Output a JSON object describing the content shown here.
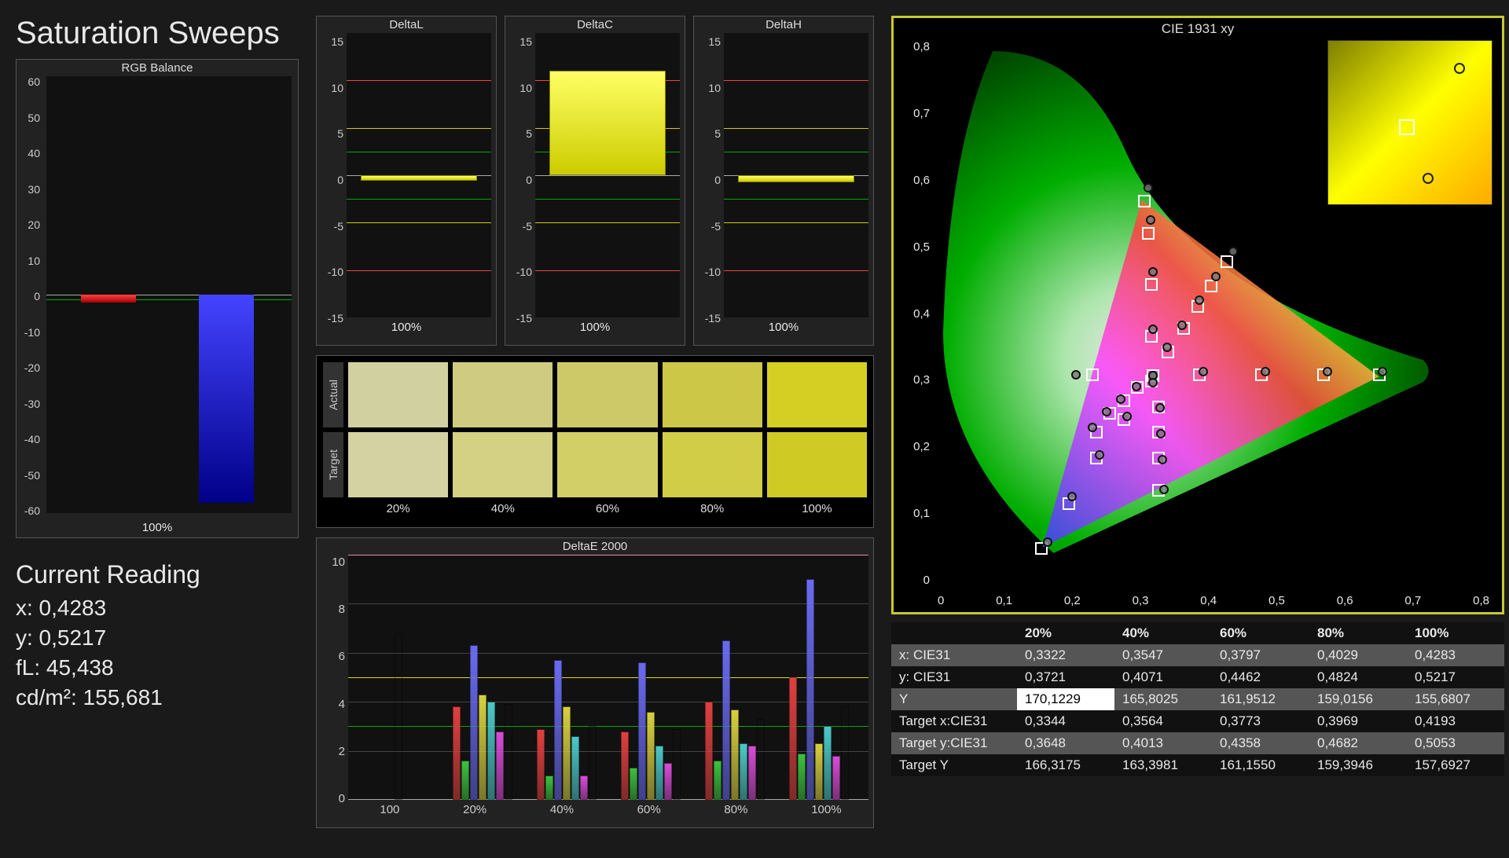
{
  "page": {
    "title": "Saturation Sweeps"
  },
  "current_reading": {
    "title": "Current Reading",
    "x": "x: 0,4283",
    "y": "y: 0,5217",
    "fL": "fL: 45,438",
    "cdm2": "cd/m²: 155,681"
  },
  "rgb_balance": {
    "title": "RGB Balance",
    "xlabel": "100%"
  },
  "delta_panels": {
    "L": {
      "title": "DeltaL",
      "xlabel": "100%"
    },
    "C": {
      "title": "DeltaC",
      "xlabel": "100%"
    },
    "H": {
      "title": "DeltaH",
      "xlabel": "100%"
    }
  },
  "swatches": {
    "row1": "Actual",
    "row2": "Target",
    "labels": [
      "20%",
      "40%",
      "60%",
      "80%",
      "100%"
    ],
    "actual": [
      "#d1d0a0",
      "#cfcc82",
      "#cdc968",
      "#cdc748",
      "#d4cf22"
    ],
    "target": [
      "#d4d2a2",
      "#d4d084",
      "#d3cf67",
      "#d1cd46",
      "#d0cb24"
    ]
  },
  "deltaE2000": {
    "title": "DeltaE 2000"
  },
  "cie": {
    "title": "CIE 1931 xy",
    "xticks": [
      "0",
      "0,1",
      "0,2",
      "0,3",
      "0,4",
      "0,5",
      "0,6",
      "0,7",
      "0,8"
    ],
    "yticks": [
      "0",
      "0,1",
      "0,2",
      "0,3",
      "0,4",
      "0,5",
      "0,6",
      "0,7",
      "0,8"
    ]
  },
  "table": {
    "columns": [
      "",
      "20%",
      "40%",
      "60%",
      "80%",
      "100%"
    ],
    "rows": [
      {
        "h": "x: CIE31",
        "v": [
          "0,3322",
          "0,3547",
          "0,3797",
          "0,4029",
          "0,4283"
        ]
      },
      {
        "h": "y: CIE31",
        "v": [
          "0,3721",
          "0,4071",
          "0,4462",
          "0,4824",
          "0,5217"
        ]
      },
      {
        "h": "Y",
        "v": [
          "170,1229",
          "165,8025",
          "161,9512",
          "159,0156",
          "155,6807"
        ],
        "hl": 0
      },
      {
        "h": "Target x:CIE31",
        "v": [
          "0,3344",
          "0,3564",
          "0,3773",
          "0,3969",
          "0,4193"
        ]
      },
      {
        "h": "Target y:CIE31",
        "v": [
          "0,3648",
          "0,4013",
          "0,4358",
          "0,4682",
          "0,5053"
        ]
      },
      {
        "h": "Target Y",
        "v": [
          "166,3175",
          "163,3981",
          "161,1550",
          "159,3946",
          "157,6927"
        ]
      }
    ]
  },
  "chart_data": [
    {
      "id": "rgb_balance",
      "type": "bar",
      "title": "RGB Balance",
      "categories": [
        "100%"
      ],
      "series": [
        {
          "name": "Red",
          "values": [
            -1.5
          ]
        },
        {
          "name": "Green",
          "values": [
            0
          ]
        },
        {
          "name": "Blue",
          "values": [
            -57
          ]
        }
      ],
      "ylim": [
        -60,
        60
      ]
    },
    {
      "id": "deltaL",
      "type": "bar",
      "title": "DeltaL",
      "categories": [
        "100%"
      ],
      "values": [
        -0.5
      ],
      "ylim": [
        -15,
        15
      ],
      "ref_lines": [
        10,
        5,
        2.5,
        0,
        -2.5,
        -5,
        -10
      ]
    },
    {
      "id": "deltaC",
      "type": "bar",
      "title": "DeltaC",
      "categories": [
        "100%"
      ],
      "values": [
        11
      ],
      "ylim": [
        -15,
        15
      ],
      "ref_lines": [
        10,
        5,
        2.5,
        0,
        -2.5,
        -5,
        -10
      ]
    },
    {
      "id": "deltaH",
      "type": "bar",
      "title": "DeltaH",
      "categories": [
        "100%"
      ],
      "values": [
        -0.7
      ],
      "ylim": [
        -15,
        15
      ],
      "ref_lines": [
        10,
        5,
        2.5,
        0,
        -2.5,
        -5,
        -10
      ]
    },
    {
      "id": "deltaE2000",
      "type": "bar",
      "title": "DeltaE 2000",
      "categories": [
        "100",
        "20%",
        "40%",
        "60%",
        "80%",
        "100%"
      ],
      "series": [
        {
          "name": "White",
          "color": "#eee",
          "values": [
            6.8,
            null,
            null,
            null,
            null,
            null
          ]
        },
        {
          "name": "Red",
          "color": "#e04040",
          "values": [
            null,
            3.8,
            2.9,
            2.8,
            4.0,
            5.0
          ]
        },
        {
          "name": "Green",
          "color": "#3cc23c",
          "values": [
            null,
            1.6,
            1.0,
            1.3,
            1.6,
            1.9
          ]
        },
        {
          "name": "Blue",
          "color": "#6a6af0",
          "values": [
            null,
            6.3,
            5.7,
            5.6,
            6.5,
            9.0
          ]
        },
        {
          "name": "Yellow",
          "color": "#d8d040",
          "values": [
            null,
            4.3,
            3.8,
            3.6,
            3.7,
            2.3
          ]
        },
        {
          "name": "Cyan",
          "color": "#4cc8c8",
          "values": [
            null,
            4.0,
            2.6,
            2.2,
            2.3,
            3.0
          ]
        },
        {
          "name": "Magenta",
          "color": "#d84cd8",
          "values": [
            null,
            2.8,
            1.0,
            1.5,
            2.2,
            1.8
          ]
        },
        {
          "name": "Avg",
          "color": "#888",
          "values": [
            null,
            3.9,
            3.0,
            2.9,
            3.3,
            3.8
          ]
        }
      ],
      "ylim": [
        0,
        10
      ],
      "ref_lines": [
        {
          "y": 3,
          "color": "green"
        },
        {
          "y": 5,
          "color": "yellow"
        },
        {
          "y": 10,
          "color": "pink"
        }
      ]
    },
    {
      "id": "cie1931",
      "type": "scatter",
      "title": "CIE 1931 xy",
      "xlim": [
        0,
        0.8
      ],
      "ylim": [
        0,
        0.85
      ],
      "targets": [
        [
          0.3127,
          0.329
        ],
        [
          0.15,
          0.06
        ],
        [
          0.19,
          0.13
        ],
        [
          0.23,
          0.2
        ],
        [
          0.27,
          0.26
        ],
        [
          0.3127,
          0.329
        ],
        [
          0.3127,
          0.329
        ],
        [
          0.38,
          0.33
        ],
        [
          0.47,
          0.33
        ],
        [
          0.56,
          0.33
        ],
        [
          0.64,
          0.33
        ],
        [
          0.3127,
          0.329
        ],
        [
          0.31,
          0.39
        ],
        [
          0.31,
          0.47
        ],
        [
          0.305,
          0.55
        ],
        [
          0.3,
          0.6
        ],
        [
          0.3344,
          0.3648
        ],
        [
          0.3564,
          0.4013
        ],
        [
          0.3773,
          0.4358
        ],
        [
          0.3969,
          0.4682
        ],
        [
          0.4193,
          0.5053
        ],
        [
          0.29,
          0.31
        ],
        [
          0.27,
          0.29
        ],
        [
          0.25,
          0.27
        ],
        [
          0.23,
          0.24
        ],
        [
          0.225,
          0.33
        ],
        [
          0.31,
          0.32
        ],
        [
          0.32,
          0.28
        ],
        [
          0.32,
          0.24
        ],
        [
          0.32,
          0.2
        ],
        [
          0.32,
          0.15
        ]
      ],
      "measured": [
        [
          0.3127,
          0.329
        ],
        [
          0.16,
          0.07
        ],
        [
          0.195,
          0.14
        ],
        [
          0.235,
          0.205
        ],
        [
          0.275,
          0.265
        ],
        [
          0.3127,
          0.329
        ],
        [
          0.3127,
          0.329
        ],
        [
          0.385,
          0.335
        ],
        [
          0.475,
          0.335
        ],
        [
          0.565,
          0.335
        ],
        [
          0.645,
          0.335
        ],
        [
          0.3127,
          0.329
        ],
        [
          0.312,
          0.4
        ],
        [
          0.312,
          0.49
        ],
        [
          0.309,
          0.57
        ],
        [
          0.305,
          0.62
        ],
        [
          0.3322,
          0.3721
        ],
        [
          0.3547,
          0.4071
        ],
        [
          0.3797,
          0.4462
        ],
        [
          0.4029,
          0.4824
        ],
        [
          0.4283,
          0.5217
        ],
        [
          0.288,
          0.312
        ],
        [
          0.266,
          0.292
        ],
        [
          0.245,
          0.272
        ],
        [
          0.225,
          0.248
        ],
        [
          0.2,
          0.33
        ],
        [
          0.312,
          0.318
        ],
        [
          0.322,
          0.278
        ],
        [
          0.324,
          0.238
        ],
        [
          0.326,
          0.198
        ],
        [
          0.328,
          0.152
        ]
      ]
    }
  ]
}
